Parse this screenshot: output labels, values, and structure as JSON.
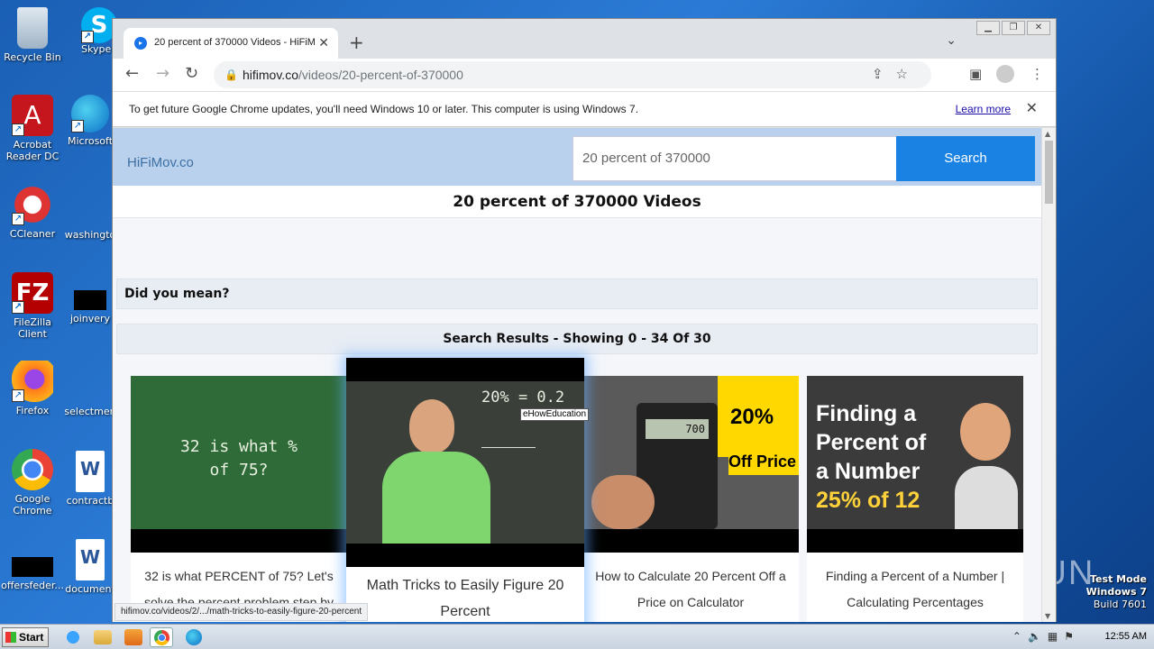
{
  "desktop": {
    "icons": [
      {
        "label": "Recycle Bin"
      },
      {
        "label": "Skype"
      },
      {
        "label": "Acrobat Reader DC"
      },
      {
        "label": "Microsoft"
      },
      {
        "label": "CCleaner"
      },
      {
        "label": "washingto"
      },
      {
        "label": "FileZilla Client"
      },
      {
        "label": "joinvery"
      },
      {
        "label": "Firefox"
      },
      {
        "label": "selectmen"
      },
      {
        "label": "Google Chrome"
      },
      {
        "label": "contractb"
      },
      {
        "label": "offersfeder..."
      },
      {
        "label": "document"
      }
    ],
    "watermark": {
      "line1": "Test Mode",
      "line2": "Windows 7",
      "line3": "Build 7601"
    },
    "anyrun": "ANY RUN"
  },
  "taskbar": {
    "start_label": "Start",
    "clock": "12:55 AM"
  },
  "browser": {
    "tab_title": "20 percent of 370000 Videos - HiFiM",
    "url_host": "hifimov.co",
    "url_path": "/videos/20-percent-of-370000",
    "infobar_text": "To get future Google Chrome updates, you'll need Windows 10 or later. This computer is using Windows 7.",
    "infobar_link": "Learn more",
    "status_url": "hifimov.co/videos/2/.../math-tricks-to-easily-figure-20-percent"
  },
  "site": {
    "brand": "HiFiMov.co",
    "search_value": "20 percent of 370000",
    "search_button": "Search",
    "page_title": "20 percent of 370000 Videos",
    "did_you_mean": "Did you mean?",
    "results_heading": "Search Results - Showing 0 - 34 Of 30",
    "tooltip": "eHowEducation",
    "videos": [
      {
        "title_line1": "32 is what PERCENT of 75? Let's",
        "title_line2": "solve the percent problem step by",
        "thumb_text": "32 is what % of 75?"
      },
      {
        "title_line1": "Math Tricks to Easily Figure 20",
        "title_line2": "Percent",
        "thumb_text": "20% = 0.2"
      },
      {
        "title_line1": "How to Calculate 20 Percent Off a",
        "title_line2": "Price on Calculator",
        "thumb_badge1": "20%",
        "thumb_badge2": "Off Price",
        "calc_display": "700"
      },
      {
        "title_line1": "Finding a Percent of a Number |",
        "title_line2": "Calculating Percentages",
        "thumb_l1": "Finding a",
        "thumb_l2": "Percent of",
        "thumb_l3": "a Number",
        "thumb_l4": "25% of 12"
      }
    ]
  }
}
